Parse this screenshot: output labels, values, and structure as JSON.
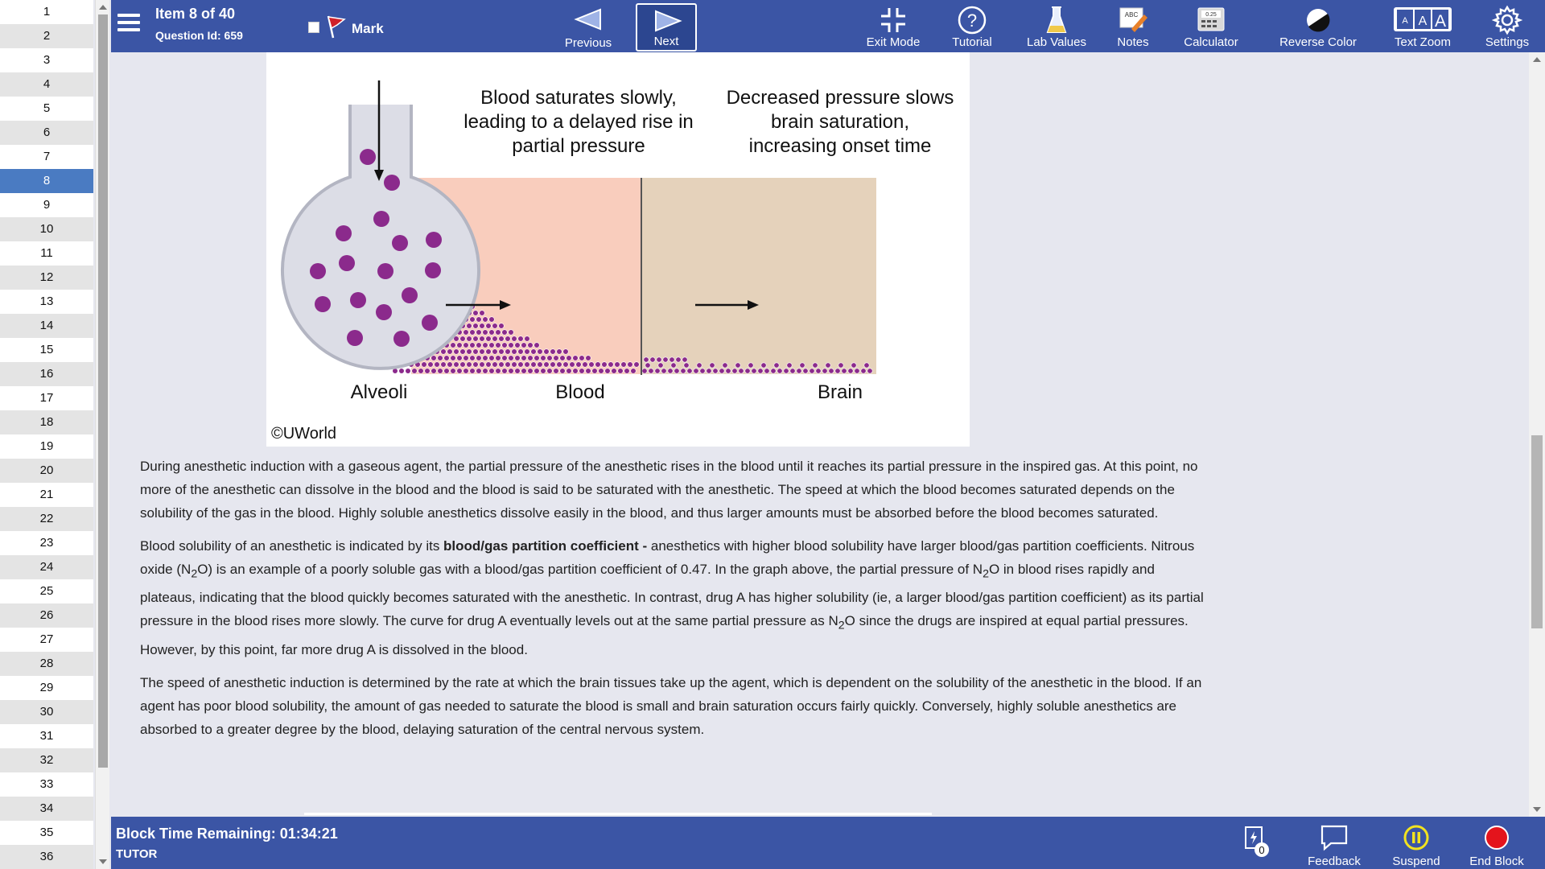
{
  "question_list": {
    "numbers": [
      "1",
      "2",
      "3",
      "4",
      "5",
      "6",
      "7",
      "8",
      "9",
      "10",
      "11",
      "12",
      "13",
      "14",
      "15",
      "16",
      "17",
      "18",
      "19",
      "20",
      "21",
      "22",
      "23",
      "24",
      "25",
      "26",
      "27",
      "28",
      "29",
      "30",
      "31",
      "32",
      "33",
      "34",
      "35",
      "36"
    ],
    "active": "8"
  },
  "header": {
    "item_title": "Item 8 of 40",
    "question_id": "Question Id: 659",
    "mark_label": "Mark",
    "previous_label": "Previous",
    "next_label": "Next",
    "tools": {
      "exit_mode": "Exit Mode",
      "tutorial": "Tutorial",
      "lab_values": "Lab Values",
      "notes": "Notes",
      "calculator": "Calculator",
      "calculator_display": "0.25",
      "notes_icon_text": "ABC",
      "reverse_color": "Reverse Color",
      "text_zoom": "Text Zoom",
      "settings": "Settings"
    }
  },
  "figure": {
    "caption_blood": "Blood saturates slowly, leading to a delayed rise in partial pressure",
    "caption_blood_lines": [
      "Blood saturates slowly,",
      "leading to a delayed rise in",
      "partial pressure"
    ],
    "caption_brain_lines": [
      "Decreased pressure slows",
      "brain saturation,",
      "increasing onset time"
    ],
    "label_alveoli": "Alveoli",
    "label_blood": "Blood",
    "label_brain": "Brain",
    "copyright": "©UWorld",
    "colors": {
      "molecule": "#8b2a8c",
      "blood_fill": "#f9cdbd",
      "brain_fill": "#e5d2bb",
      "alveoli_fill": "#dcdde6"
    }
  },
  "explanation": {
    "p1": "During anesthetic induction with a gaseous agent, the partial pressure of the anesthetic rises in the blood until it reaches its partial pressure in the inspired gas.  At this point, no more of the anesthetic can dissolve in the blood and the blood is said to be saturated with the anesthetic.  The speed at which the blood becomes saturated depends on the solubility of the gas in the blood.  Highly soluble anesthetics dissolve easily in the blood, and thus larger amounts must be absorbed before the blood becomes saturated.",
    "p2_a": "Blood solubility of an anesthetic is indicated by its ",
    "p2_bold": "blood/gas partition coefficient -",
    "p2_b": " anesthetics with higher blood solubility have larger blood/gas partition coefficients.  Nitrous oxide (N",
    "p2_sub1": "2",
    "p2_c": "O) is an example of a poorly soluble gas with a blood/gas partition coefficient of 0.47.  In the graph above, the partial pressure of N",
    "p2_sub2": "2",
    "p2_d": "O in blood rises rapidly and plateaus, indicating that the blood quickly becomes saturated with the anesthetic.  In contrast, drug A has higher solubility (ie, a larger blood/gas partition coefficient) as its partial pressure in the blood rises more slowly.  The curve for drug A eventually levels out at the same partial pressure as N",
    "p2_sub3": "2",
    "p2_e": "O since the drugs are inspired at equal partial pressures.  However, by this point, far more drug A is dissolved in the blood.",
    "p3": "The speed of anesthetic induction is determined by the rate at which the brain tissues take up the agent, which is dependent on the solubility of the anesthetic in the blood.  If an agent has poor blood solubility, the amount of gas needed to saturate the blood is small and brain saturation occurs fairly quickly.  Conversely, highly soluble anesthetics are absorbed to a greater degree by the blood, delaying saturation of the central nervous system."
  },
  "footer": {
    "time_remaining": "Block Time Remaining: 01:34:21",
    "mode": "TUTOR",
    "badge_count": "0",
    "feedback": "Feedback",
    "suspend": "Suspend",
    "end_block": "End Block"
  }
}
